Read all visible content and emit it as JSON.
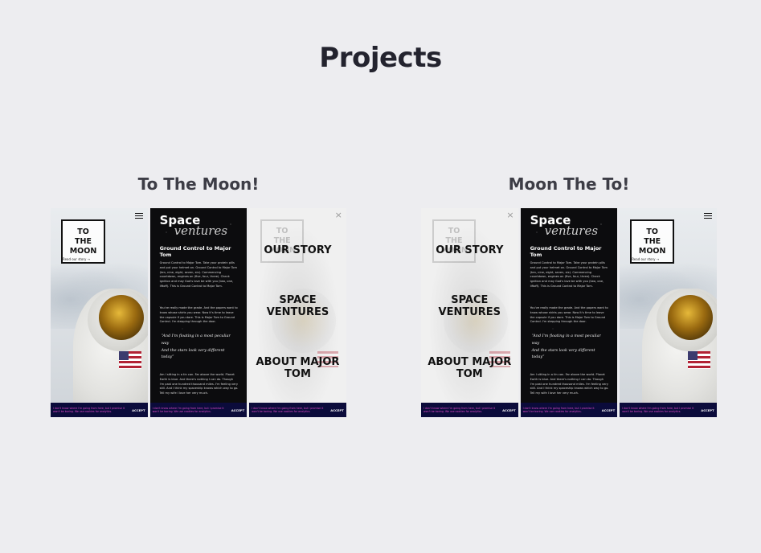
{
  "page": {
    "title": "Projects"
  },
  "projects": [
    {
      "title": "To The Moon!",
      "astro": {
        "logo_lines": [
          "TO",
          "THE",
          "MOON"
        ],
        "logo_sub": "Read our story  →",
        "icon": "hamburger-menu-icon"
      },
      "text": {
        "brand_top": "Space",
        "brand_bottom": "ventures",
        "heading": "Ground Control to Major Tom",
        "para_a": "Ground Control to Major Tom. Take your protein pills and put your helmet on. Ground Control to Major Tom (ten, nine, eight, seven, six). Commencing countdown, engines on (five, four, three). Check ignition and may God's love be with you (two, one, liftoff). This is Ground Control to Major Tom.",
        "para_b": "You've really made the grade. And the papers want to know whose shirts you wear. Now it's time to leave the capsule if you dare. This is Major Tom to Ground Control. I'm stepping through the door.",
        "quote": [
          "“And I'm floating in a most peculiar way",
          "And the stars look very different today”"
        ],
        "para_c": "Am I sitting in a tin can. Far above the world. Planet Earth is blue. And there's nothing I can do. Though I'm past one hundred thousand miles. I'm feeling very still. And I think my spaceship knows which way to go. Tell my wife I love her very much."
      },
      "menu": {
        "items": [
          "OUR STORY",
          "SPACE VENTURES",
          "ABOUT MAJOR TOM"
        ],
        "ghost_logo": [
          "TO",
          "THE",
          "MOON"
        ],
        "close": "×"
      },
      "banner": {
        "text": "I don't know where I'm going from here, but I promise it won't be boring. We use cookies for analytics.",
        "accept": "ACCEPT"
      }
    },
    {
      "title": "Moon The To!",
      "astro": {
        "logo_lines": [
          "TO",
          "THE",
          "MOON"
        ],
        "logo_sub": "Read our story  →",
        "icon": "hamburger-menu-icon"
      },
      "text": {
        "brand_top": "Space",
        "brand_bottom": "ventures",
        "heading": "Ground Control to Major Tom",
        "para_a": "Ground Control to Major Tom. Take your protein pills and put your helmet on. Ground Control to Major Tom (ten, nine, eight, seven, six). Commencing countdown, engines on (five, four, three). Check ignition and may God's love be with you (two, one, liftoff). This is Ground Control to Major Tom.",
        "para_b": "You've really made the grade. And the papers want to know whose shirts you wear. Now it's time to leave the capsule if you dare. This is Major Tom to Ground Control. I'm stepping through the door.",
        "quote": [
          "“And I'm floating in a most peculiar way",
          "And the stars look very different today”"
        ],
        "para_c": "Am I sitting in a tin can. Far above the world. Planet Earth is blue. And there's nothing I can do. Though I'm past one hundred thousand miles. I'm feeling very still. And I think my spaceship knows which way to go. Tell my wife I love her very much."
      },
      "menu": {
        "items": [
          "OUR STORY",
          "SPACE VENTURES",
          "ABOUT MAJOR TOM"
        ],
        "ghost_logo": [
          "TO",
          "THE",
          "MOON"
        ],
        "close": "×"
      },
      "banner": {
        "text": "I don't know where I'm going from here, but I promise it won't be boring. We use cookies for analytics.",
        "accept": "ACCEPT"
      }
    }
  ]
}
